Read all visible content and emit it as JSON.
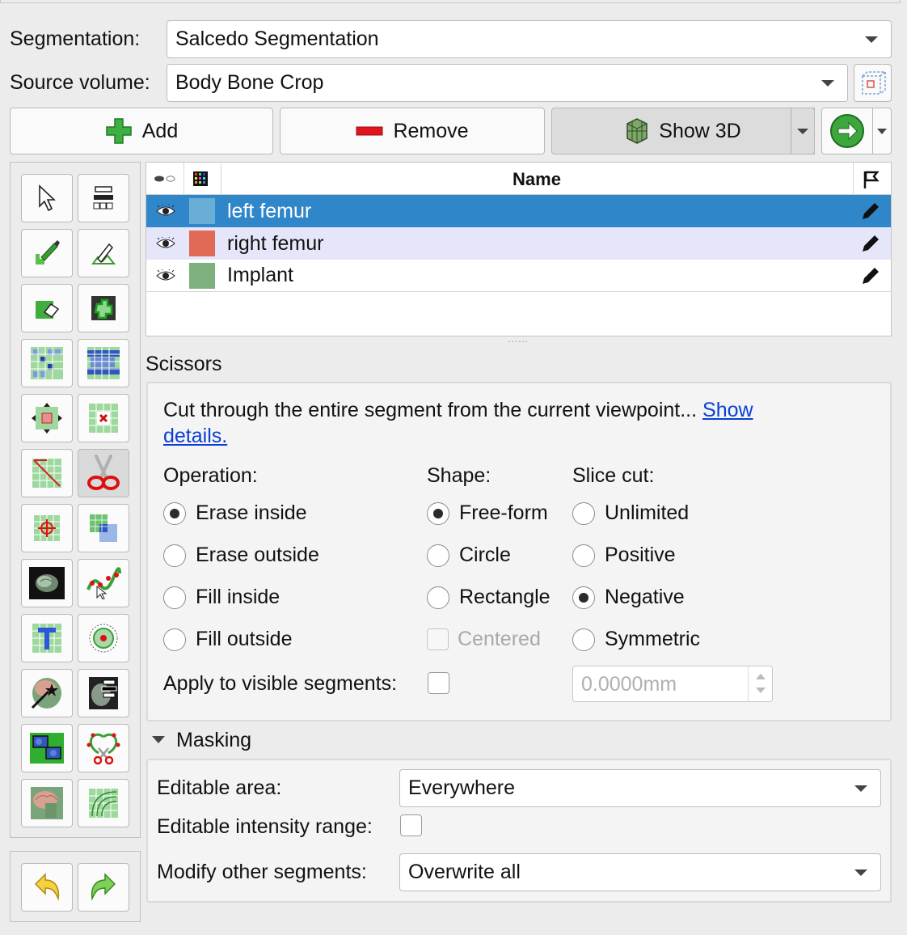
{
  "header": {
    "segmentation_label": "Segmentation:",
    "segmentation_value": "Salcedo Segmentation",
    "source_label": "Source volume:",
    "source_value": "Body Bone Crop"
  },
  "buttons": {
    "add": "Add",
    "remove": "Remove",
    "show3d": "Show 3D"
  },
  "table": {
    "name_header": "Name",
    "rows": [
      {
        "name": "left femur",
        "color": "#6aaed8",
        "selected": true
      },
      {
        "name": "right femur",
        "color": "#e06a55",
        "selected": false
      },
      {
        "name": "Implant",
        "color": "#7fb07f",
        "selected": false
      }
    ],
    "splitter_dots": "......"
  },
  "effect": {
    "title": "Scissors",
    "description": "Cut through the entire segment from the current viewpoint...",
    "link_show": "Show",
    "link_details": "details.",
    "operation_label": "Operation:",
    "shape_label": "Shape:",
    "slice_label": "Slice cut:",
    "operations": [
      "Erase inside",
      "Erase outside",
      "Fill inside",
      "Fill outside"
    ],
    "shapes": [
      "Free-form",
      "Circle",
      "Rectangle"
    ],
    "centered": "Centered",
    "slice_cuts": [
      "Unlimited",
      "Positive",
      "Negative",
      "Symmetric"
    ],
    "apply_visible_label": "Apply to visible segments:",
    "thickness_value": "0.0000mm"
  },
  "masking": {
    "title": "Masking",
    "editable_area_label": "Editable area:",
    "editable_area_value": "Everywhere",
    "intensity_label": "Editable intensity range:",
    "modify_label": "Modify other segments:",
    "modify_value": "Overwrite all"
  },
  "colors": {
    "selection": "#2f86c9",
    "row_alt": "#e6e6fa",
    "add_green": "#3cb043",
    "remove_red": "#e0141e"
  }
}
